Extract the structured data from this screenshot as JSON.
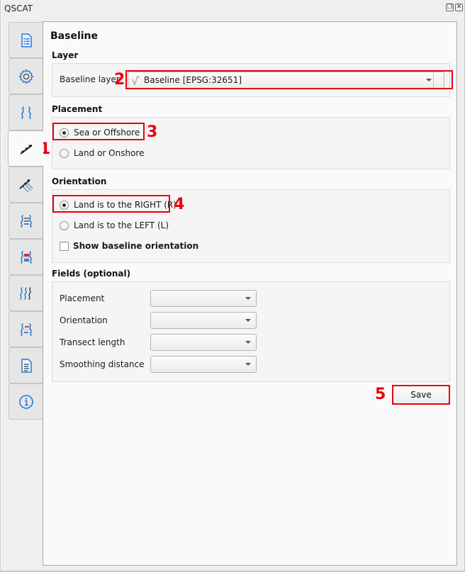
{
  "window": {
    "title": "QSCAT",
    "float_icon": "float-icon",
    "close_icon": "close-icon"
  },
  "sidebar": {
    "tabs": [
      {
        "id": "project-settings",
        "icon": "list-document-icon",
        "active": false
      },
      {
        "id": "automator",
        "icon": "gear-icon",
        "active": false
      },
      {
        "id": "shorelines",
        "icon": "shoreline-waves-icon",
        "active": false
      },
      {
        "id": "baseline",
        "icon": "baseline-arrows-icon",
        "active": true
      },
      {
        "id": "transects",
        "icon": "transects-arrows-icon",
        "active": false
      },
      {
        "id": "shoreline-change",
        "icon": "shoreline-change-icon",
        "active": false
      },
      {
        "id": "area-change",
        "icon": "area-change-icon",
        "active": false
      },
      {
        "id": "forecasting",
        "icon": "forecasting-waves-icon",
        "active": false
      },
      {
        "id": "visualization",
        "icon": "visualization-icon",
        "active": false
      },
      {
        "id": "summary-reports",
        "icon": "report-document-icon",
        "active": false
      },
      {
        "id": "about",
        "icon": "info-icon",
        "active": false
      }
    ]
  },
  "main": {
    "title": "Baseline",
    "layer": {
      "section_label": "Layer",
      "field_label": "Baseline layer",
      "selected_value": "Baseline [EPSG:32651]",
      "layer_icon": "line-layer-icon"
    },
    "placement": {
      "section_label": "Placement",
      "options": [
        {
          "label": "Sea or Offshore",
          "checked": true
        },
        {
          "label": "Land or Onshore",
          "checked": false
        }
      ]
    },
    "orientation": {
      "section_label": "Orientation",
      "options": [
        {
          "label": "Land is to the RIGHT (R)",
          "checked": true
        },
        {
          "label": "Land is to the LEFT (L)",
          "checked": false
        }
      ],
      "show_orientation_label": "Show baseline orientation",
      "show_orientation_checked": false
    },
    "fields": {
      "section_label": "Fields (optional)",
      "rows": [
        {
          "label": "Placement",
          "value": ""
        },
        {
          "label": "Orientation",
          "value": ""
        },
        {
          "label": "Transect length",
          "value": ""
        },
        {
          "label": "Smoothing distance",
          "value": ""
        }
      ]
    },
    "save_label": "Save"
  },
  "annotations": {
    "color": "#e8000b",
    "markers": [
      "1",
      "2",
      "3",
      "4",
      "5"
    ]
  }
}
